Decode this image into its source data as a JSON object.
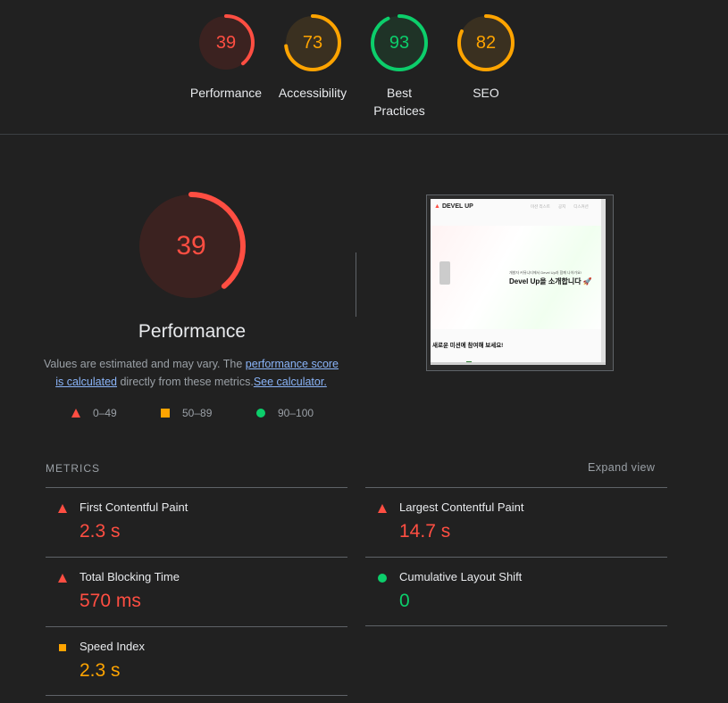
{
  "colors": {
    "fail": "#ff4e42",
    "average": "#ffa400",
    "pass": "#0cce6b"
  },
  "categories": [
    {
      "name": "Performance",
      "score": 39,
      "status": "fail"
    },
    {
      "name": "Accessibility",
      "score": 73,
      "status": "average"
    },
    {
      "name": "Best Practices",
      "score": 93,
      "status": "pass"
    },
    {
      "name": "SEO",
      "score": 82,
      "status": "average"
    }
  ],
  "main": {
    "score": 39,
    "title": "Performance",
    "desc_text_1": "Values are estimated and may vary. The ",
    "desc_link_1": "performance score is calculated",
    "desc_text_2": " directly from these metrics.",
    "desc_link_2": "See calculator."
  },
  "legend": [
    {
      "icon": "triangle-icon",
      "label": "0–49"
    },
    {
      "icon": "square-icon",
      "label": "50–89"
    },
    {
      "icon": "circle-icon",
      "label": "90–100"
    }
  ],
  "screenshot": {
    "logo": "DEVEL UP",
    "nav": [
      "미션 리스트",
      "공지",
      "디스커션"
    ],
    "hero_sub": "개발자 커뮤니티에서 Devel Up과 함께 나아가요!",
    "hero_title": "Devel Up을 소개합니다 🚀",
    "section_title": "새로운 미션에 참여해 보세요!"
  },
  "metrics": {
    "heading": "METRICS",
    "expand_label": "Expand view",
    "items": [
      {
        "label": "First Contentful Paint",
        "value": "2.3 s",
        "status": "fail"
      },
      {
        "label": "Largest Contentful Paint",
        "value": "14.7 s",
        "status": "fail"
      },
      {
        "label": "Total Blocking Time",
        "value": "570 ms",
        "status": "fail"
      },
      {
        "label": "Cumulative Layout Shift",
        "value": "0",
        "status": "pass"
      },
      {
        "label": "Speed Index",
        "value": "2.3 s",
        "status": "average"
      }
    ]
  }
}
